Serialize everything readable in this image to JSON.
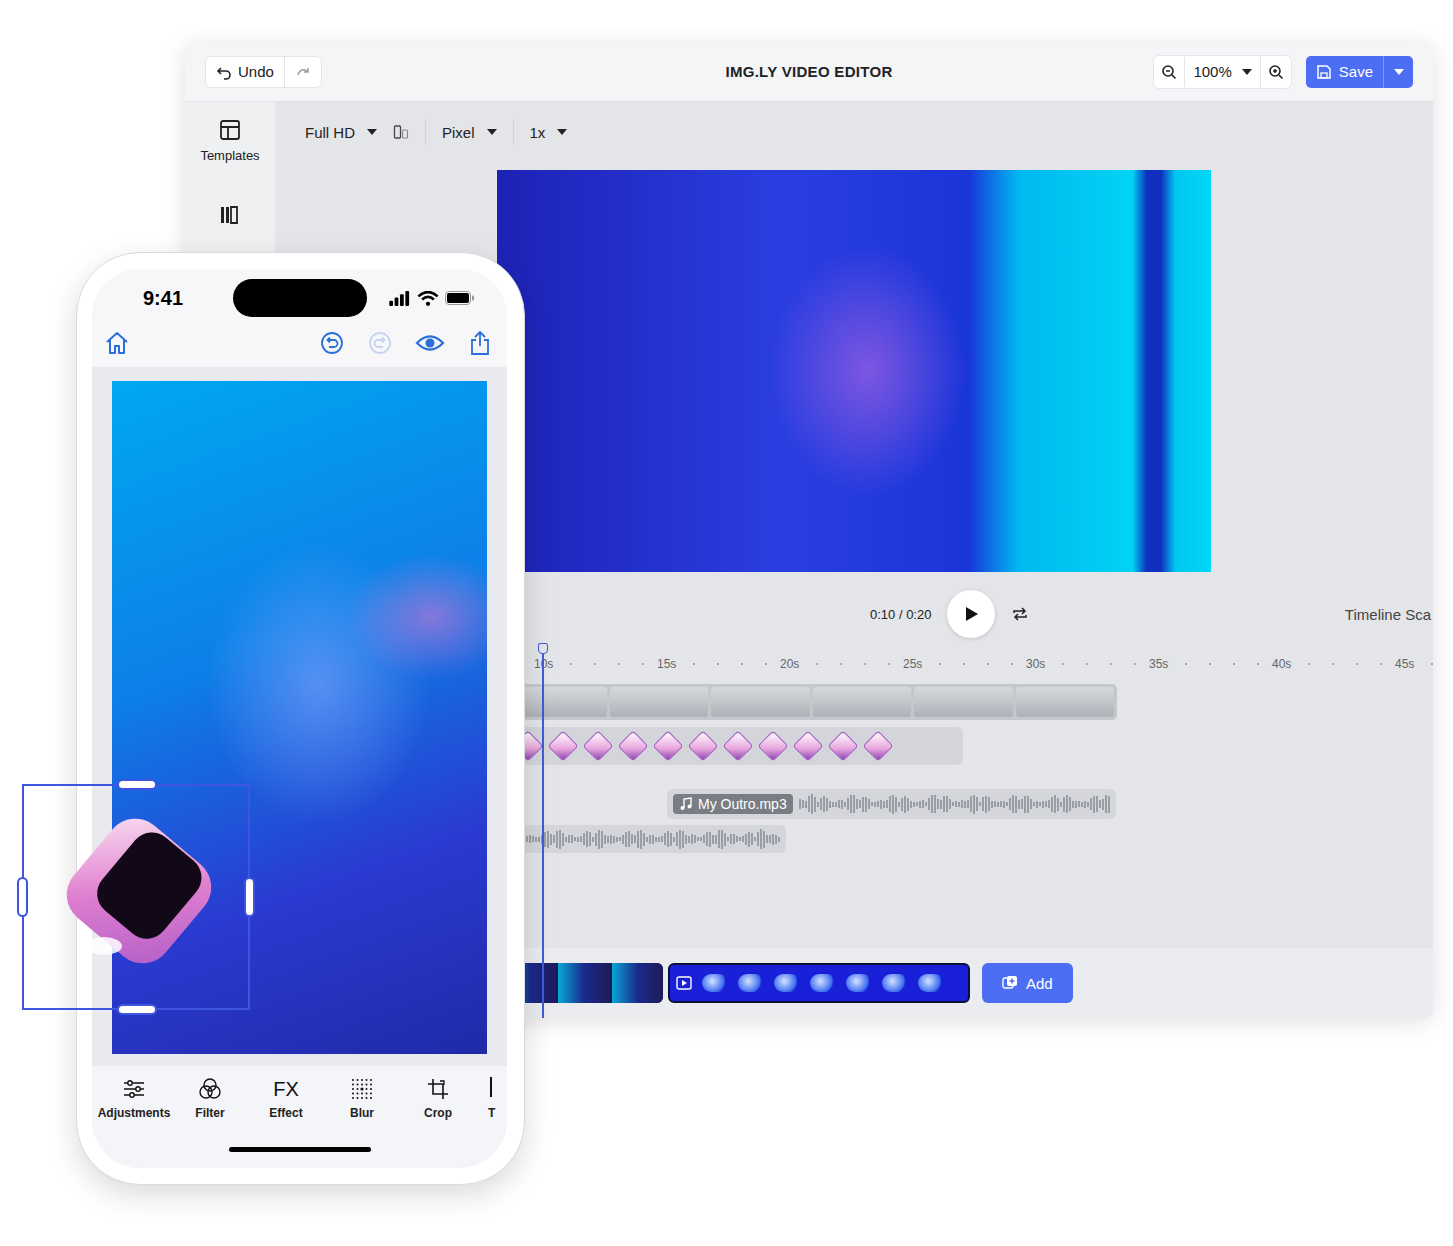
{
  "window": {
    "title": "IMG.LY VIDEO EDITOR"
  },
  "topbar": {
    "undo": "Undo",
    "redo_disabled": true,
    "zoom": "100%",
    "save": "Save"
  },
  "sidebar": {
    "items": [
      {
        "label": "Templates",
        "selected": false
      }
    ]
  },
  "toolbar": {
    "resolution": "Full HD",
    "unit": "Pixel",
    "speed": "1x"
  },
  "player": {
    "current": "0:10",
    "separator": "/",
    "duration": "0:20",
    "playing": false,
    "timeline_label": "Timeline Sca"
  },
  "ruler": {
    "ticks": [
      "10s",
      "15s",
      "20s",
      "25s",
      "30s",
      "35s",
      "40s",
      "45s"
    ]
  },
  "tracks": [
    {
      "kind": "text",
      "frames": 6
    },
    {
      "kind": "sticker",
      "frames": 11
    },
    {
      "kind": "audio",
      "label": "My Outro.mp3"
    },
    {
      "kind": "audio"
    }
  ],
  "clips": [
    {
      "kind": "photo",
      "frames": 3
    },
    {
      "kind": "video",
      "frames": 7
    }
  ],
  "add_button": "Add",
  "phone": {
    "time": "9:41",
    "redo_disabled": true,
    "tools": [
      {
        "label": "Adjustments",
        "kind": "icon"
      },
      {
        "label": "Filter",
        "kind": "icon"
      },
      {
        "label": "Effect",
        "kind": "glyph",
        "glyph": "FX"
      },
      {
        "label": "Blur",
        "kind": "icon"
      },
      {
        "label": "Crop",
        "kind": "icon"
      },
      {
        "label": "T",
        "kind": "partial"
      }
    ]
  },
  "selection": {
    "selected": true
  }
}
